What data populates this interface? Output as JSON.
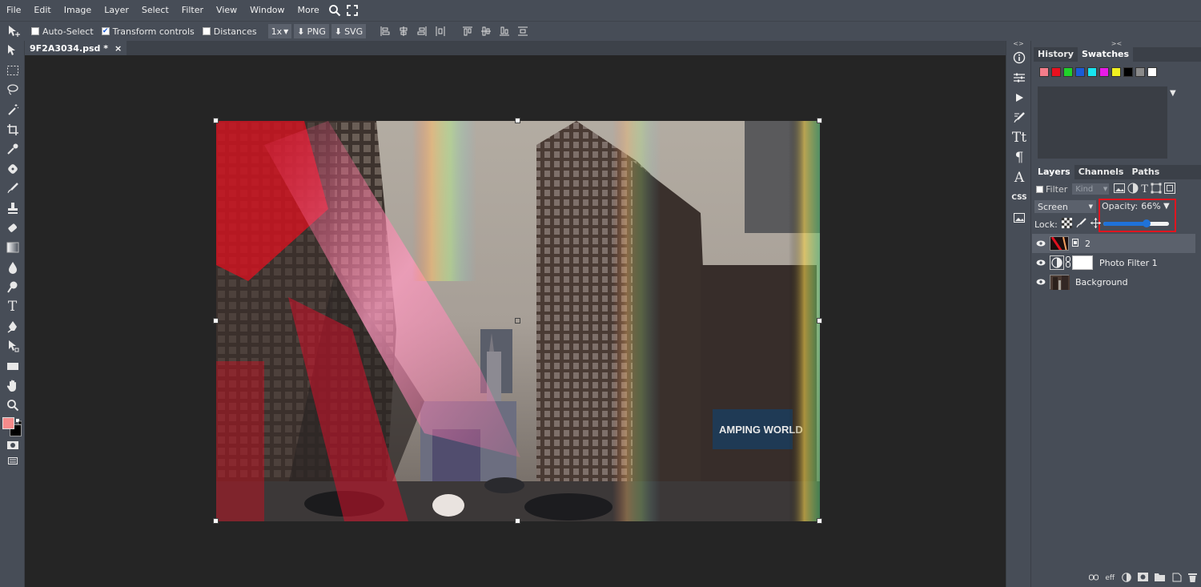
{
  "menu": {
    "items": [
      "File",
      "Edit",
      "Image",
      "Layer",
      "Select",
      "Filter",
      "View",
      "Window",
      "More"
    ]
  },
  "options": {
    "auto_select": "Auto-Select",
    "transform_controls": "Transform controls",
    "distances": "Distances",
    "zoom": "1x",
    "png": "PNG",
    "svg": "SVG"
  },
  "document": {
    "tab_title": "9F2A3034.psd *",
    "close": "×",
    "sign_text": "AMPING WORLD"
  },
  "history_panel": {
    "tabs": [
      "History",
      "Swatches"
    ],
    "swatches": [
      "#f47d8b",
      "#e8101f",
      "#20d22a",
      "#1a5bd7",
      "#18e5f0",
      "#e81be8",
      "#f0f020",
      "#000000",
      "#8a8a8a",
      "#ffffff"
    ]
  },
  "layers_panel": {
    "tabs": [
      "Layers",
      "Channels",
      "Paths"
    ],
    "filter_label": "Filter",
    "kind_placeholder": "Kind",
    "blend_mode": "Screen",
    "opacity_label": "Opacity:",
    "opacity_value": "66%",
    "opacity_level": 0.66,
    "lock_label": "Lock:",
    "layers": [
      {
        "name": "2",
        "selected": true
      },
      {
        "name": "Photo Filter 1",
        "selected": false
      },
      {
        "name": "Background",
        "selected": false
      }
    ]
  },
  "strip": {
    "css_label": "CSS",
    "collapse_left": "<>",
    "collapse_right": "><"
  },
  "bottom_bar": {
    "eff_label": "eff"
  },
  "colors": {
    "foreground": "#f48b8b",
    "background": "#000000",
    "highlight_box": "#e0151f"
  }
}
